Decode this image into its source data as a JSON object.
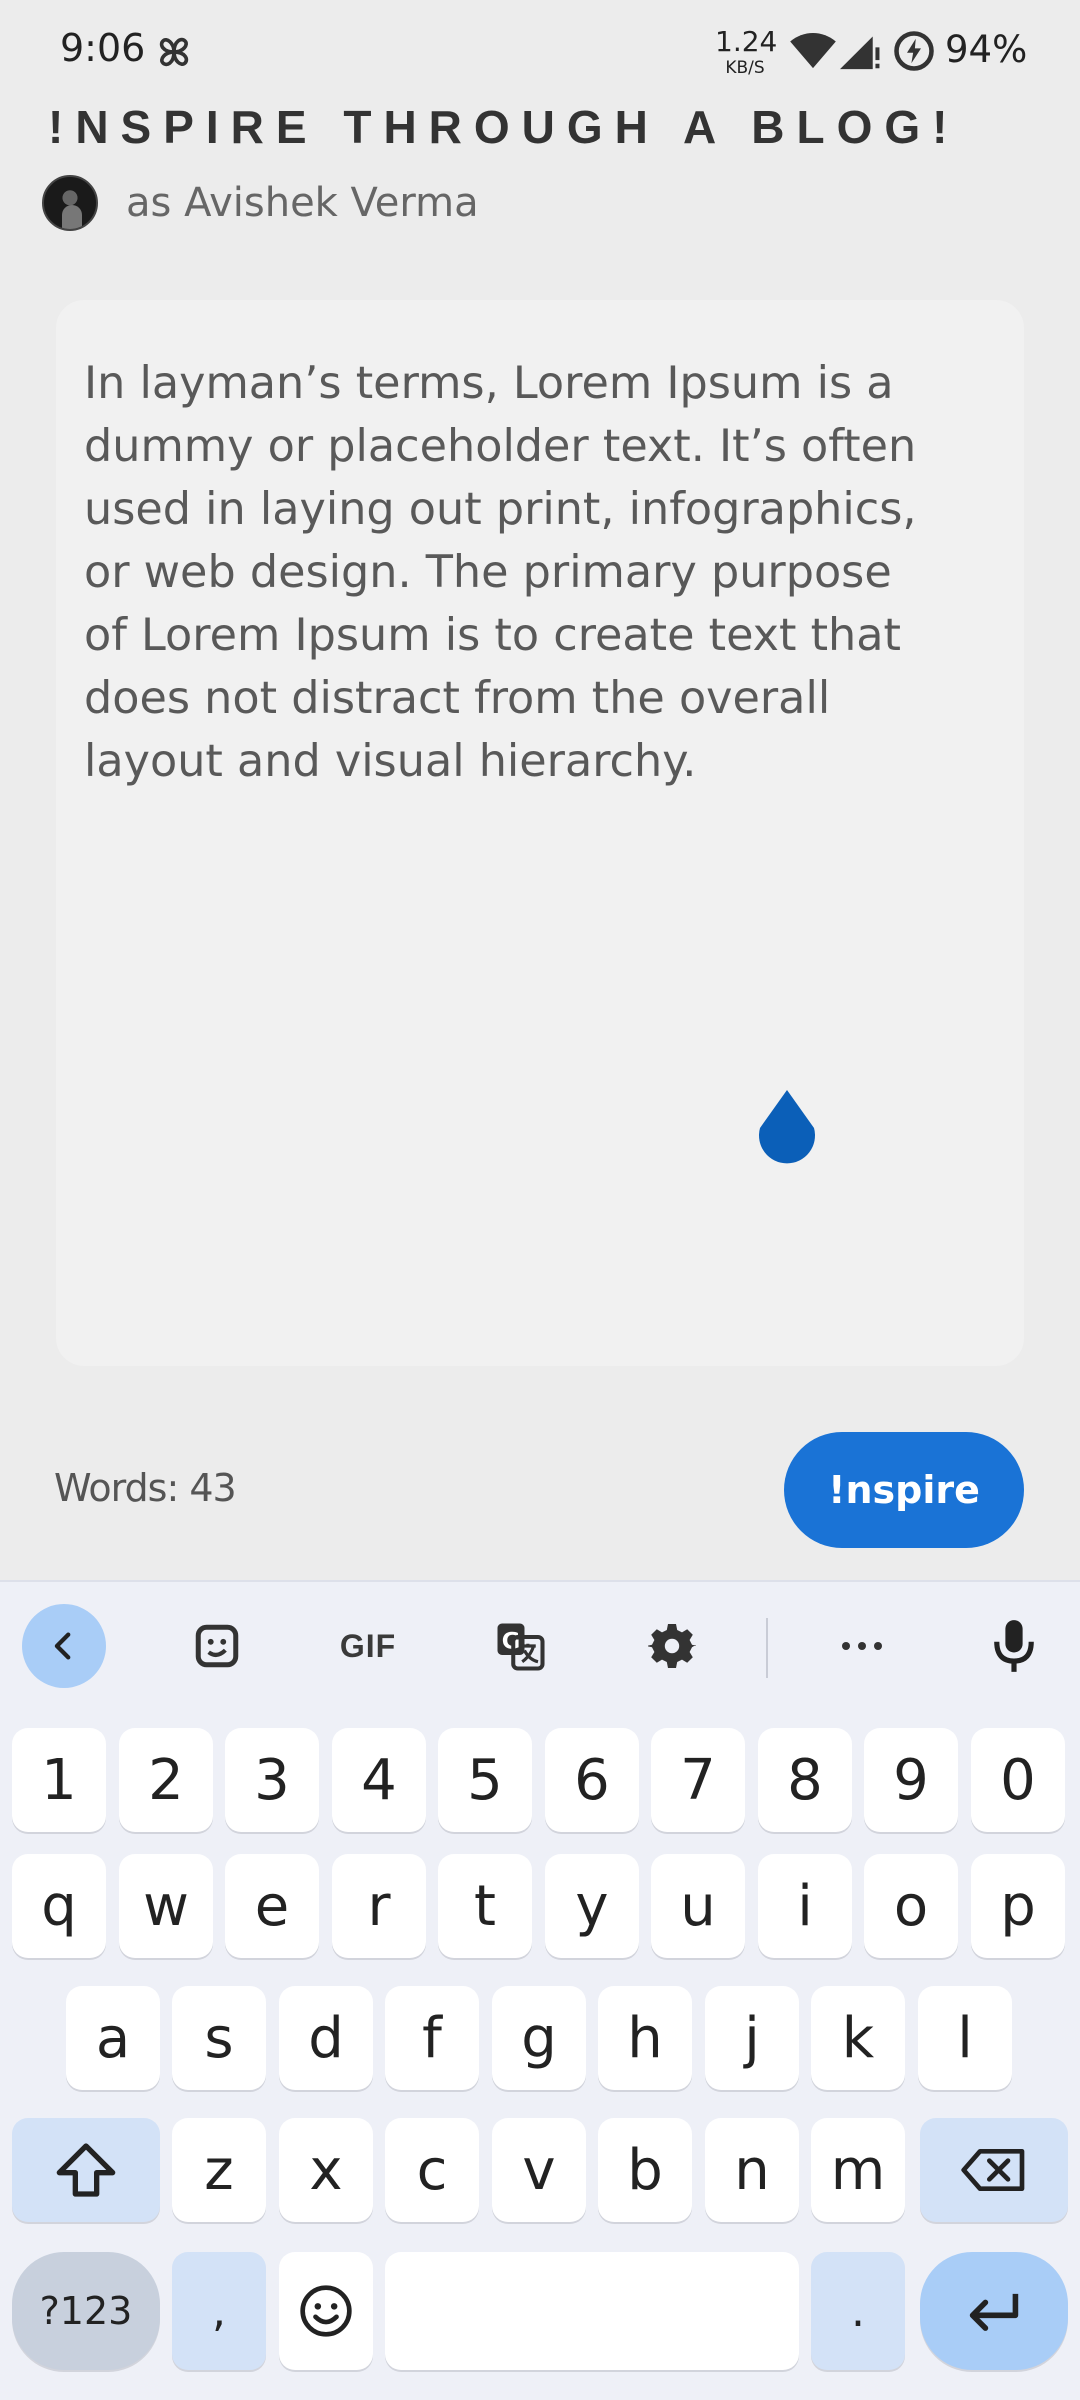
{
  "status_bar": {
    "time": "9:06",
    "net_speed_value": "1.24",
    "net_speed_unit": "KB/S",
    "battery_percent": "94%"
  },
  "header": {
    "title": "!NSPIRE THROUGH A BLOG!",
    "author_label": "as Avishek Verma"
  },
  "editor": {
    "body_text": "In layman’s terms, Lorem Ipsum is a\ndummy or placeholder text. It’s often\nused in laying out print, infographics,\nor web design. The primary purpose\nof Lorem Ipsum is to create text that\ndoes not distract from the overall\nlayout and visual hierarchy."
  },
  "footer": {
    "word_count": "Words: 43",
    "inspire_label": "!nspire"
  },
  "keyboard": {
    "toolbar": [
      "chevron-left-icon",
      "sticker-icon",
      "GIF",
      "translate-icon",
      "gear-icon",
      "more-icon",
      "mic-icon"
    ],
    "gif_label": "GIF",
    "row_numbers": [
      "1",
      "2",
      "3",
      "4",
      "5",
      "6",
      "7",
      "8",
      "9",
      "0"
    ],
    "row_1": [
      "q",
      "w",
      "e",
      "r",
      "t",
      "y",
      "u",
      "i",
      "o",
      "p"
    ],
    "row_2": [
      "a",
      "s",
      "d",
      "f",
      "g",
      "h",
      "j",
      "k",
      "l"
    ],
    "row_3": [
      "z",
      "x",
      "c",
      "v",
      "b",
      "n",
      "m"
    ],
    "mode_label": "?123",
    "comma_label": ",",
    "period_label": "."
  },
  "colors": {
    "accent": "#1a73d6",
    "cursor_handle": "#0b5fb8",
    "background": "#ececec",
    "keyboard_bg": "#eef0f7"
  }
}
